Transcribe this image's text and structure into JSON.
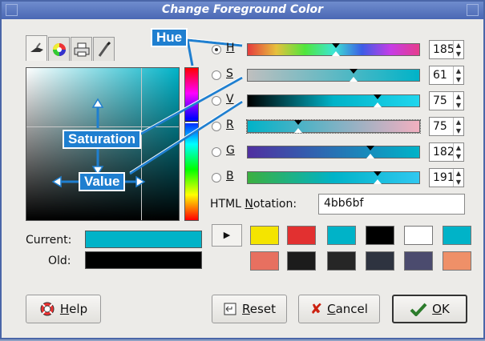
{
  "window": {
    "title": "Change Foreground Color"
  },
  "tabs": [
    {
      "icon": "brush-scales-icon"
    },
    {
      "icon": "color-wheel-icon"
    },
    {
      "icon": "printer-icon"
    },
    {
      "icon": "paintbrush-icon"
    }
  ],
  "callouts": {
    "hue": "Hue",
    "saturation": "Saturation",
    "value": "Value"
  },
  "preview": {
    "current_label": "Current:",
    "old_label": "Old:",
    "current_color": "#00b3c8",
    "old_color": "#000000"
  },
  "channels": [
    {
      "key": "H",
      "value": "185",
      "selected": true,
      "marker": 0.51
    },
    {
      "key": "S",
      "value": "61",
      "selected": false,
      "marker": 0.61
    },
    {
      "key": "V",
      "value": "75",
      "selected": false,
      "marker": 0.75
    },
    {
      "key": "R",
      "value": "75",
      "selected": false,
      "marker": 0.29
    },
    {
      "key": "G",
      "value": "182",
      "selected": false,
      "marker": 0.71
    },
    {
      "key": "B",
      "value": "191",
      "selected": false,
      "marker": 0.75
    }
  ],
  "html_notation": {
    "label_pre": "HTML ",
    "label_underlined": "N",
    "label_post": "otation:",
    "value": "4bb6bf"
  },
  "history": {
    "row1": [
      "#f4e400",
      "#e23030",
      "#00b3c8",
      "#000000",
      "#ffffff",
      "#00b3c8"
    ],
    "row2": [
      "#e77060",
      "#1c1c1c",
      "#262626",
      "#2e3340",
      "#4b4b6e",
      "#ef9068"
    ]
  },
  "buttons": {
    "help": "Help",
    "help_u": "H",
    "help_rest": "elp",
    "reset": "Reset",
    "reset_u": "R",
    "reset_rest": "eset",
    "cancel": "Cancel",
    "cancel_u": "C",
    "cancel_rest": "ancel",
    "ok": "OK",
    "ok_u": "O",
    "ok_rest": "K"
  }
}
